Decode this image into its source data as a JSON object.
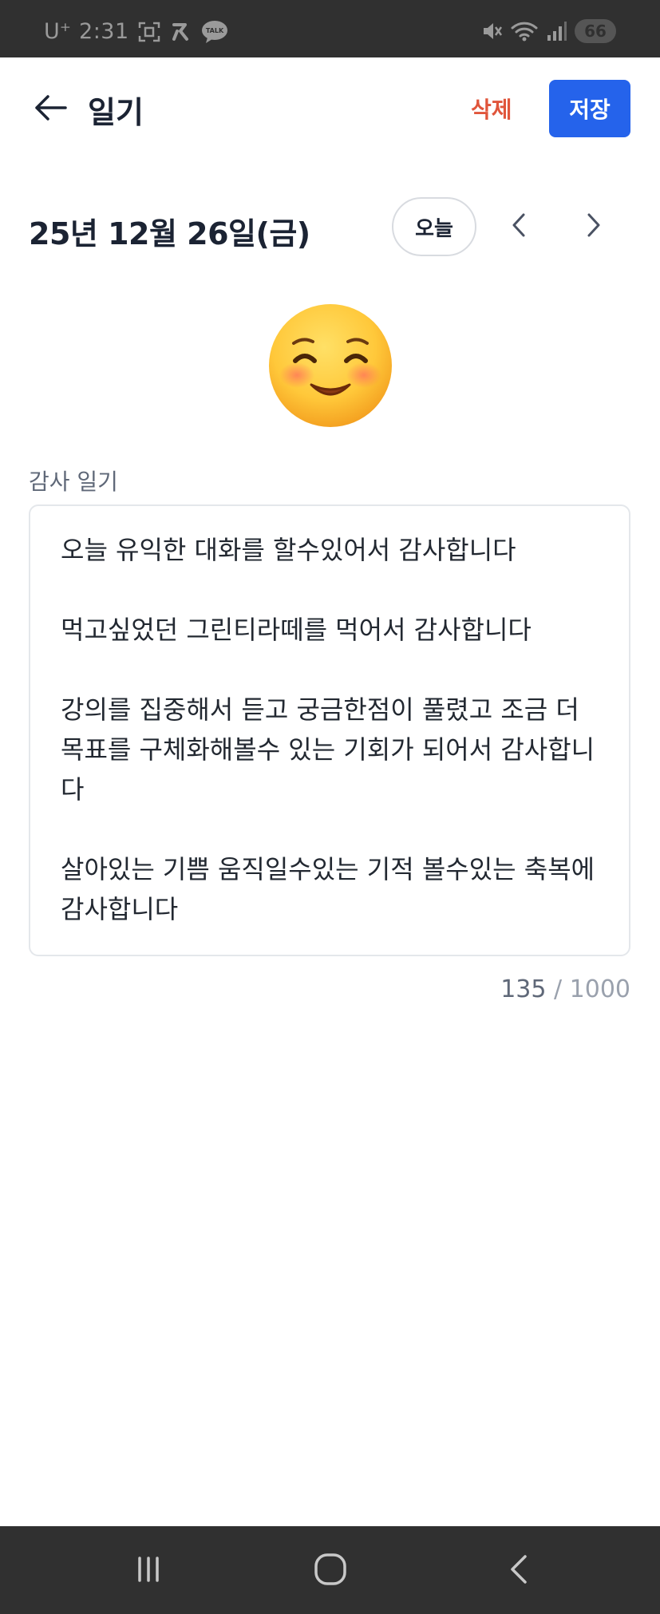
{
  "status_bar": {
    "carrier": "U⁺",
    "time": "2:31",
    "battery": "66",
    "icons": [
      "screenshot-icon",
      "app-icon",
      "kakaotalk-icon",
      "mute-icon",
      "wifi-icon",
      "signal-icon"
    ]
  },
  "header": {
    "title": "일기",
    "delete_label": "삭제",
    "save_label": "저장",
    "back_icon": "arrow-left-icon"
  },
  "date_nav": {
    "date": "25년 12월 26일(금)",
    "today_label": "오늘",
    "prev_icon": "chevron-left-icon",
    "next_icon": "chevron-right-icon"
  },
  "mood": {
    "emoji": "smiling-face-with-smiling-eyes"
  },
  "diary": {
    "label": "감사 일기",
    "content": "오늘 유익한 대화를 할수있어서 감사합니다\n\n먹고싶었던 그린티라떼를 먹어서 감사합니다\n\n강의를 집중해서 듣고 궁금한점이 풀렸고 조금 더 목표를 구체화해볼수 있는 기회가 되어서 감사합니다\n\n살아있는 기쁨 움직일수있는 기적 볼수있는 축복에 감사합니다",
    "count": "135",
    "max": "/ 1000"
  },
  "colors": {
    "accent": "#2563eb",
    "danger": "#e0553b",
    "text": "#1b2333",
    "muted": "#5f6878",
    "system_bar": "#303030"
  },
  "system_nav": {
    "icons": [
      "recent-apps-icon",
      "home-icon",
      "back-icon"
    ]
  }
}
